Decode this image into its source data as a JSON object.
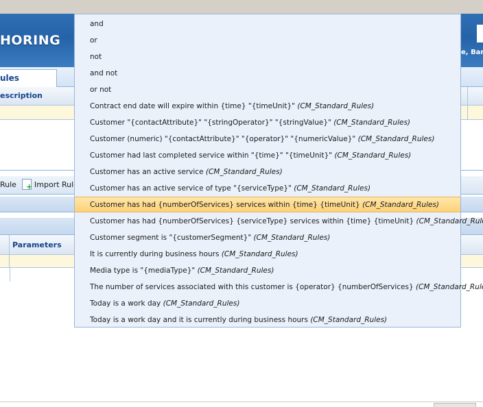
{
  "app": {
    "brand_fragment": "HORING",
    "user_fragment": "e, Barr"
  },
  "tabs": [
    {
      "label": "ules"
    }
  ],
  "rules_grid": {
    "column_header": "escription"
  },
  "toolbar": {
    "rule_label": "Rule",
    "import_label": "Import Rule"
  },
  "parameters_grid": {
    "column_header": "Parameters"
  },
  "dropdown": {
    "items": [
      {
        "text": "and",
        "source": ""
      },
      {
        "text": "or",
        "source": ""
      },
      {
        "text": "not",
        "source": ""
      },
      {
        "text": "and not",
        "source": ""
      },
      {
        "text": "or not",
        "source": ""
      },
      {
        "text": "Contract end date will expire within {time} \"{timeUnit}\" ",
        "source": "(CM_Standard_Rules)"
      },
      {
        "text": "Customer \"{contactAttribute}\" \"{stringOperator}\" \"{stringValue}\" ",
        "source": "(CM_Standard_Rules)"
      },
      {
        "text": "Customer (numeric) \"{contactAttribute}\" \"{operator}\" \"{numericValue}\" ",
        "source": "(CM_Standard_Rules)"
      },
      {
        "text": "Customer had last completed service within \"{time}\" \"{timeUnit}\" ",
        "source": "(CM_Standard_Rules)"
      },
      {
        "text": "Customer has an active service ",
        "source": "(CM_Standard_Rules)"
      },
      {
        "text": "Customer has an active service of type \"{serviceType}\" ",
        "source": "(CM_Standard_Rules)"
      },
      {
        "text": "Customer has had {numberOfServices} services within {time} {timeUnit} ",
        "source": "(CM_Standard_Rules)"
      },
      {
        "text": "Customer has had {numberOfServices} {serviceType} services within {time} {timeUnit} ",
        "source": "(CM_Standard_Rules)"
      },
      {
        "text": "Customer segment is \"{customerSegment}\" ",
        "source": "(CM_Standard_Rules)"
      },
      {
        "text": "It is currently during business hours ",
        "source": "(CM_Standard_Rules)"
      },
      {
        "text": "Media type is \"{mediaType}\" ",
        "source": "(CM_Standard_Rules)"
      },
      {
        "text": "The number of services associated with this customer is {operator} {numberOfServices} ",
        "source": "(CM_Standard_Rules)"
      },
      {
        "text": "Today is a work day ",
        "source": "(CM_Standard_Rules)"
      },
      {
        "text": "Today is a work day and it is currently during business hours ",
        "source": "(CM_Standard_Rules)"
      }
    ]
  }
}
